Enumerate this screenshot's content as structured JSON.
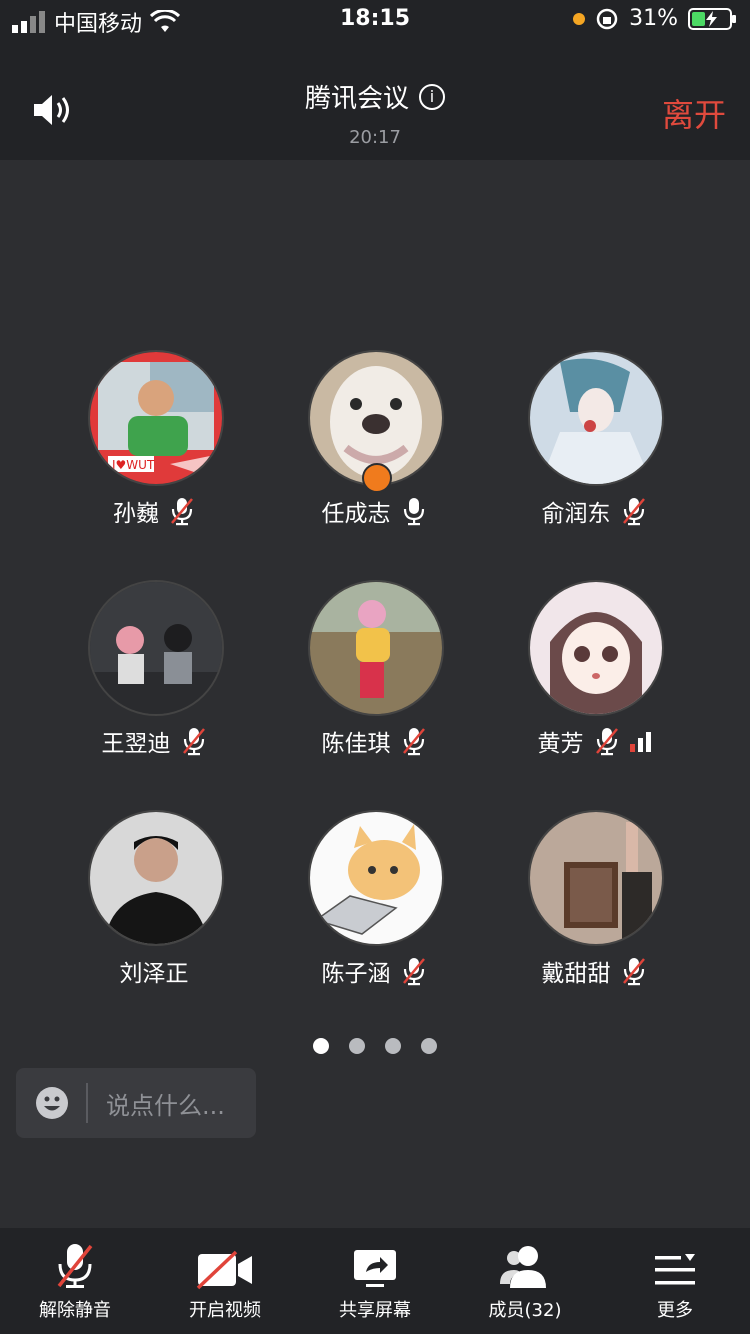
{
  "status_bar": {
    "carrier": "中国移动",
    "time": "18:15",
    "battery": "31%"
  },
  "header": {
    "title": "腾讯会议",
    "duration": "20:17",
    "leave_label": "离开"
  },
  "participants": [
    {
      "name": "孙巍",
      "mic": "muted"
    },
    {
      "name": "任成志",
      "mic": "on",
      "host": true
    },
    {
      "name": "俞润东",
      "mic": "muted"
    },
    {
      "name": "王翌迪",
      "mic": "muted"
    },
    {
      "name": "陈佳琪",
      "mic": "muted"
    },
    {
      "name": "黄芳",
      "mic": "muted",
      "signal_level": 1
    },
    {
      "name": "刘泽正",
      "mic": "none"
    },
    {
      "name": "陈子涵",
      "mic": "muted"
    },
    {
      "name": "戴甜甜",
      "mic": "muted"
    }
  ],
  "pager": {
    "count": 4,
    "active": 1
  },
  "chat": {
    "placeholder": "说点什么..."
  },
  "toolbar": {
    "unmute": "解除静音",
    "video": "开启视频",
    "share": "共享屏幕",
    "members": "成员(32)",
    "more": "更多"
  },
  "colors": {
    "leave": "#e04a3d",
    "host_badge": "#f07b1d",
    "muted_slash": "#e0443a"
  }
}
